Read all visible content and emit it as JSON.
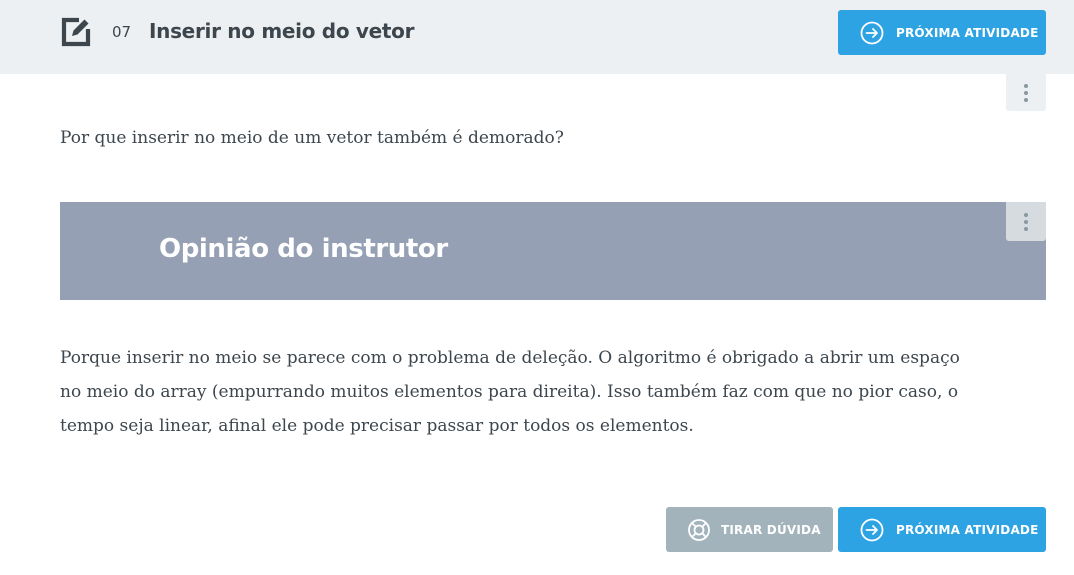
{
  "header": {
    "task_number": "07",
    "task_title": "Inserir no meio do vetor",
    "next_button_label": "PRÓXIMA ATIVIDADE"
  },
  "content": {
    "question": "Por que inserir no meio de um vetor também é demorado?",
    "opinion_title": "Opinião do instrutor",
    "answer": "Porque inserir no meio se parece com o problema de deleção. O algoritmo é obrigado a abrir um espaço no meio do array (empurrando muitos elementos para direita). Isso também faz com que no pior caso, o tempo seja linear, afinal ele pode precisar passar por todos os elementos."
  },
  "footer": {
    "help_button_label": "TIRAR DÚVIDA",
    "next_button_label": "PRÓXIMA ATIVIDADE"
  },
  "colors": {
    "accent": "#2ea3e4",
    "help_button": "#a3b3bc",
    "opinion_banner": "#95a0b5",
    "topbar": "#edf0f2",
    "text": "#3d464d"
  },
  "icons": {
    "task": "edit-task-icon",
    "next": "arrow-circle-right-icon",
    "help": "lifebuoy-icon",
    "menu": "vertical-dots-icon"
  }
}
